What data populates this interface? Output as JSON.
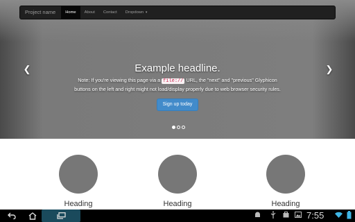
{
  "navbar": {
    "brand": "Project name",
    "items": [
      {
        "label": "Home"
      },
      {
        "label": "About"
      },
      {
        "label": "Contact"
      },
      {
        "label": "Dropdown"
      }
    ]
  },
  "carousel": {
    "headline": "Example headline.",
    "note_before": "Note: If you're viewing this page via a ",
    "note_code": "file://",
    "note_after": " URL, the \"next\" and \"previous\" Glyphicon buttons on the left and right might not load/display properly due to web browser security rules.",
    "button": "Sign up today",
    "arrow_left_icon": "chevron-left-icon",
    "arrow_right_icon": "chevron-right-icon",
    "active_slide": 1,
    "slide_count": 3
  },
  "features": [
    {
      "heading": "Heading"
    },
    {
      "heading": "Heading"
    },
    {
      "heading": "Heading"
    }
  ],
  "systembar": {
    "time": "7:55",
    "icons": [
      "back-icon",
      "home-icon",
      "recent-apps-icon",
      "android-debug-icon",
      "usb-icon",
      "shopping-bag-icon",
      "image-icon",
      "wifi-icon",
      "battery-icon"
    ]
  },
  "colors": {
    "primary_button": "#428bca",
    "navbar_bg": "#202020",
    "code_text": "#c7254e"
  }
}
